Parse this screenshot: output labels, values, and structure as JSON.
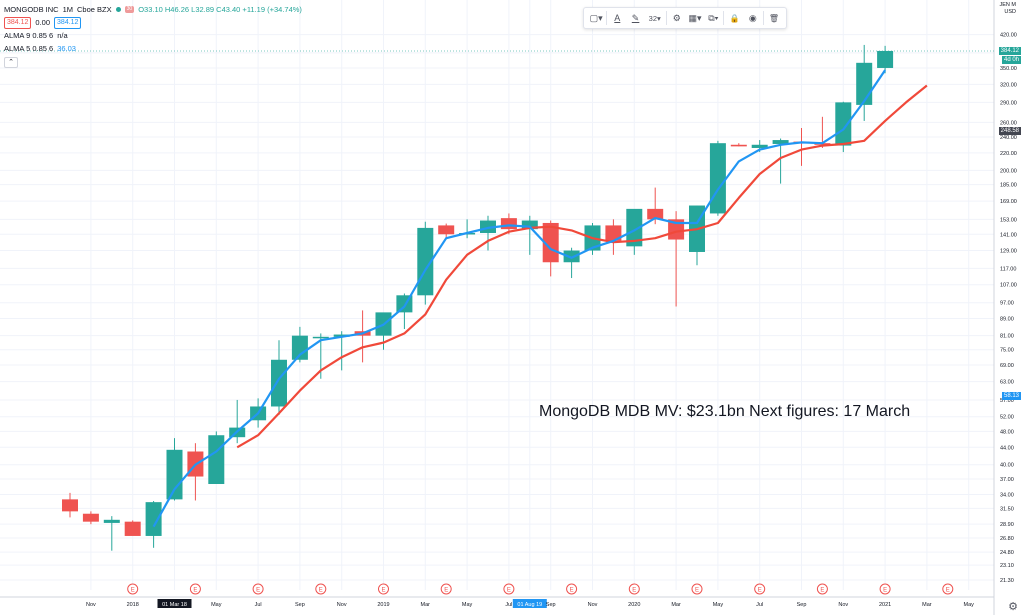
{
  "header": {
    "symbol": "MONGODB INC",
    "interval": "1M",
    "exchange": "Cboe BZX",
    "symbol_tag": "30",
    "ohlc": "O33.10 H46.26 L32.89 C43.40 +11.19 (+34.74%)",
    "sell_price": "384.12",
    "spread": "0.00",
    "buy_price": "384.12",
    "indicators": [
      {
        "label": "ALMA 9 0.85 6",
        "value": "n/a"
      },
      {
        "label": "ALMA 5 0.85 6",
        "value": "36.03"
      }
    ],
    "collapse_glyph": "⌃"
  },
  "toolbar": {
    "items": [
      {
        "name": "rectangle-icon",
        "glyph": "▢▾"
      },
      {
        "name": "text-color-icon",
        "glyph": "A"
      },
      {
        "name": "pen-color-icon",
        "glyph": "✎"
      },
      {
        "name": "font-size-select",
        "glyph": "32▾"
      },
      {
        "name": "settings-gear-icon",
        "glyph": "⚙"
      },
      {
        "name": "template-icon",
        "glyph": "▦▾"
      },
      {
        "name": "clone-icon",
        "glyph": "⧉▾"
      },
      {
        "name": "lock-icon",
        "glyph": "🔒"
      },
      {
        "name": "visibility-eye-icon",
        "glyph": "◉"
      },
      {
        "name": "trash-icon",
        "glyph": "🗑"
      }
    ]
  },
  "axis_unit": {
    "top": "JEN M",
    "bottom": "USD"
  },
  "annotation": "MongoDB  MDB MV: $23.1bn Next figures: 17 March",
  "price_labels": [
    {
      "value": 384.12,
      "text": "384.12",
      "color": "#26a69a",
      "subtext": "4d 0h"
    },
    {
      "value": 248.58,
      "text": "248.58",
      "color": "#434651"
    },
    {
      "value": 58.13,
      "text": "58.13",
      "color": "#2196f3"
    }
  ],
  "earnings_marker": "E",
  "colors": {
    "up": "#26a69a",
    "down": "#ef5350",
    "alma9": "#f0493a",
    "alma5": "#2196f3",
    "grid": "#f0f3fa",
    "crosshair_label": "#131722"
  },
  "chart_data": {
    "type": "candlestick",
    "x_scale": "monthly",
    "y_scale": "log",
    "ylim": [
      21.3,
      450
    ],
    "y_ticks": [
      21.3,
      23.1,
      24.8,
      26.8,
      28.9,
      31.5,
      34.0,
      37.0,
      40.0,
      44.0,
      48.0,
      52.0,
      57.0,
      63.0,
      69.0,
      75.0,
      81.0,
      89.0,
      97.0,
      107.0,
      117.0,
      129.0,
      141.0,
      153.0,
      169.0,
      185.0,
      200.0,
      220.0,
      240.0,
      260.0,
      290.0,
      320.0,
      350.0,
      380.0,
      420.0
    ],
    "y_tick_labels": [
      "21.30",
      "23.10",
      "24.80",
      "26.80",
      "28.90",
      "31.50",
      "34.00",
      "37.00",
      "40.00",
      "44.00",
      "48.00",
      "52.00",
      "57.00",
      "63.00",
      "69.00",
      "75.00",
      "81.00",
      "89.00",
      "97.00",
      "107.00",
      "117.00",
      "129.00",
      "141.00",
      "153.00",
      "169.00",
      "185.00",
      "200.00",
      "220.00",
      "240.00",
      "260.00",
      "290.00",
      "320.00",
      "350.00",
      "380.00",
      "420.00"
    ],
    "x_labels": [
      "Nov",
      "2018",
      "01 Mar 18",
      "May",
      "Jul",
      "Sep",
      "Nov",
      "2019",
      "Mar",
      "May",
      "Jul",
      "01 Aug 19",
      "Sep",
      "Nov",
      "2020",
      "Mar",
      "May",
      "Jul",
      "Sep",
      "Nov",
      "2021",
      "Mar",
      "May"
    ],
    "x_label_index": [
      1,
      3,
      5,
      7,
      9,
      11,
      13,
      15,
      17,
      19,
      21,
      22,
      23,
      25,
      27,
      29,
      31,
      33,
      35,
      37,
      39,
      41,
      43
    ],
    "highlighted_x_labels": [
      "01 Mar 18",
      "01 Aug 19"
    ],
    "earnings_index": [
      3,
      6,
      9,
      12,
      15,
      18,
      21,
      24,
      27,
      30,
      33,
      36,
      39,
      42
    ],
    "candles": [
      {
        "o": 33.1,
        "h": 34.3,
        "l": 30.0,
        "c": 31.0
      },
      {
        "o": 30.6,
        "h": 31.0,
        "l": 28.9,
        "c": 29.3
      },
      {
        "o": 29.1,
        "h": 30.2,
        "l": 25.0,
        "c": 29.6
      },
      {
        "o": 29.3,
        "h": 29.5,
        "l": 27.5,
        "c": 27.1
      },
      {
        "o": 27.1,
        "h": 32.8,
        "l": 25.4,
        "c": 32.6
      },
      {
        "o": 33.1,
        "h": 46.26,
        "l": 32.89,
        "c": 43.4
      },
      {
        "o": 43.0,
        "h": 45.0,
        "l": 32.9,
        "c": 37.5
      },
      {
        "o": 36.0,
        "h": 48.0,
        "l": 36.0,
        "c": 47.0
      },
      {
        "o": 46.5,
        "h": 57.0,
        "l": 45.0,
        "c": 49.0
      },
      {
        "o": 51.0,
        "h": 57.5,
        "l": 49.0,
        "c": 55.0
      },
      {
        "o": 55.0,
        "h": 79.0,
        "l": 52.5,
        "c": 71.0
      },
      {
        "o": 71.0,
        "h": 85.0,
        "l": 70.0,
        "c": 81.0
      },
      {
        "o": 80.0,
        "h": 82.0,
        "l": 64.0,
        "c": 80.5
      },
      {
        "o": 80.5,
        "h": 83.0,
        "l": 67.0,
        "c": 81.5
      },
      {
        "o": 83.0,
        "h": 93.0,
        "l": 70.0,
        "c": 81.0
      },
      {
        "o": 81.0,
        "h": 91.0,
        "l": 75.0,
        "c": 92.0
      },
      {
        "o": 92.0,
        "h": 102.0,
        "l": 84.0,
        "c": 101.0
      },
      {
        "o": 101.0,
        "h": 151.0,
        "l": 96.0,
        "c": 146.0
      },
      {
        "o": 148.0,
        "h": 149.5,
        "l": 138.0,
        "c": 141.0
      },
      {
        "o": 141.0,
        "h": 153.0,
        "l": 138.0,
        "c": 142.0
      },
      {
        "o": 142.0,
        "h": 156.0,
        "l": 129.0,
        "c": 152.0
      },
      {
        "o": 154.0,
        "h": 158.0,
        "l": 141.0,
        "c": 145.0
      },
      {
        "o": 145.0,
        "h": 156.0,
        "l": 126.0,
        "c": 152.0
      },
      {
        "o": 150.0,
        "h": 152.0,
        "l": 112.0,
        "c": 121.0
      },
      {
        "o": 121.0,
        "h": 131.0,
        "l": 111.0,
        "c": 129.0
      },
      {
        "o": 129.0,
        "h": 150.0,
        "l": 126.0,
        "c": 148.0
      },
      {
        "o": 148.0,
        "h": 153.0,
        "l": 126.0,
        "c": 136.0
      },
      {
        "o": 132.0,
        "h": 158.0,
        "l": 126.0,
        "c": 162.0
      },
      {
        "o": 162.0,
        "h": 182.0,
        "l": 149.0,
        "c": 153.0
      },
      {
        "o": 153.0,
        "h": 160.0,
        "l": 95.0,
        "c": 137.0
      },
      {
        "o": 128.0,
        "h": 165.0,
        "l": 119.0,
        "c": 165.0
      },
      {
        "o": 158.0,
        "h": 235.0,
        "l": 156.0,
        "c": 232.0
      },
      {
        "o": 230.0,
        "h": 232.0,
        "l": 228.0,
        "c": 228.0
      },
      {
        "o": 226.0,
        "h": 236.0,
        "l": 221.0,
        "c": 230.0
      },
      {
        "o": 231.0,
        "h": 238.0,
        "l": 186.0,
        "c": 236.0
      },
      {
        "o": 234.0,
        "h": 252.0,
        "l": 205.0,
        "c": 232.0
      },
      {
        "o": 232.0,
        "h": 268.0,
        "l": 226.0,
        "c": 230.0
      },
      {
        "o": 229.0,
        "h": 291.0,
        "l": 221.0,
        "c": 290.0
      },
      {
        "o": 286.0,
        "h": 397.0,
        "l": 262.0,
        "c": 360.0
      },
      {
        "o": 350.0,
        "h": 395.0,
        "l": 340.0,
        "c": 384.12
      }
    ],
    "series": [
      {
        "name": "ALMA 9 0.85 6",
        "start_index": 8,
        "values": [
          44.0,
          47.0,
          53.0,
          60.0,
          67.0,
          72.0,
          76.0,
          78.0,
          82.0,
          91.0,
          110.0,
          126.0,
          136.0,
          143.0,
          146.0,
          147.0,
          144.0,
          138.0,
          135.0,
          136.0,
          138.0,
          143.0,
          145.0,
          150.0,
          172.0,
          196.0,
          214.0,
          224.0,
          229.0,
          231.0,
          235.0,
          262.0,
          290.0,
          318.0
        ]
      },
      {
        "name": "ALMA 5 0.85 6",
        "start_index": 4,
        "values": [
          28.5,
          35.0,
          40.0,
          43.0,
          48.0,
          53.0,
          64.0,
          73.0,
          79.0,
          80.5,
          82.0,
          86.0,
          95.0,
          116.0,
          138.0,
          142.0,
          146.0,
          148.0,
          147.0,
          130.0,
          124.0,
          131.0,
          136.0,
          144.0,
          154.0,
          150.0,
          150.0,
          180.0,
          210.0,
          224.0,
          230.0,
          233.0,
          232.0,
          250.0,
          292.0,
          346.0
        ]
      }
    ]
  }
}
